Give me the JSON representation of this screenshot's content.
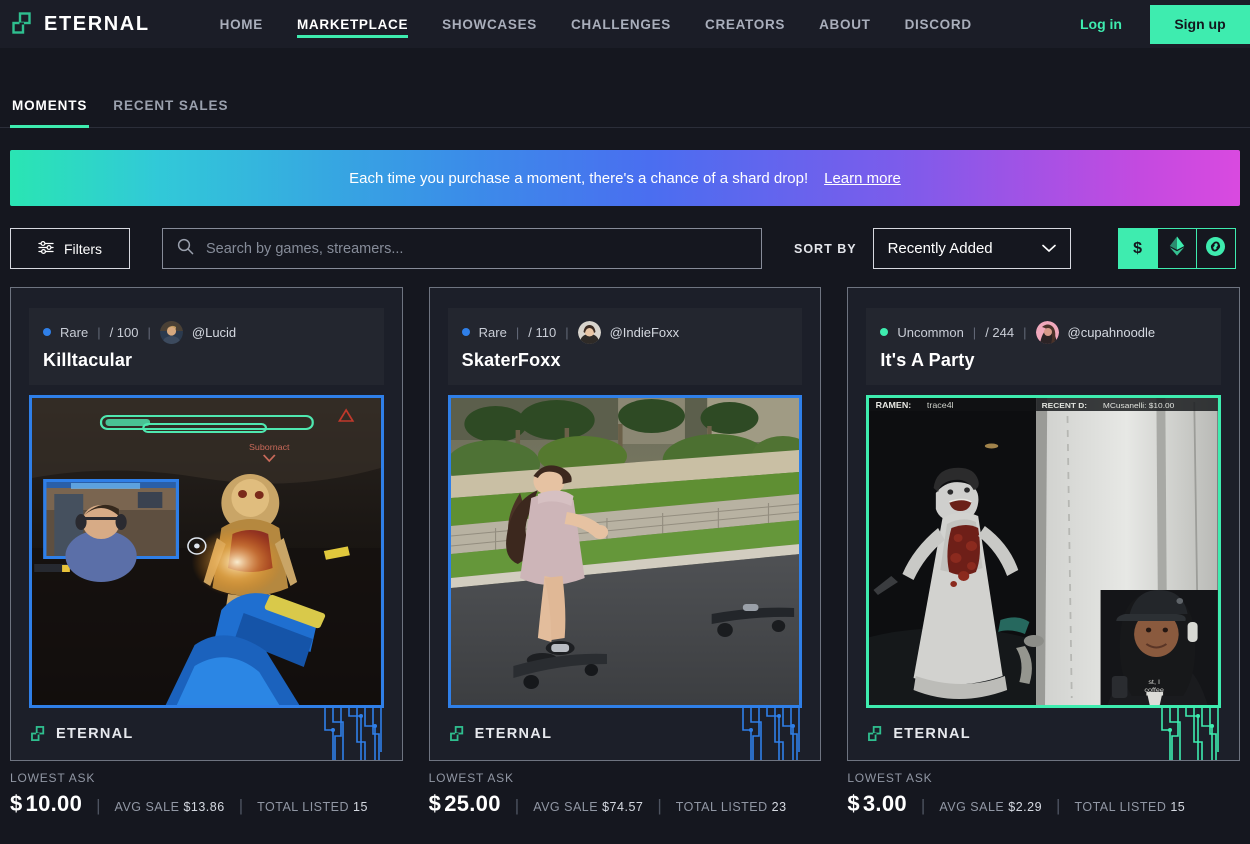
{
  "brand": {
    "name": "ETERNAL",
    "logo_icon": "eternal-squares-logo",
    "accent": "#3eecaf"
  },
  "nav": {
    "links": [
      {
        "label": "HOME",
        "active": false
      },
      {
        "label": "MARKETPLACE",
        "active": true
      },
      {
        "label": "SHOWCASES",
        "active": false
      },
      {
        "label": "CHALLENGES",
        "active": false
      },
      {
        "label": "CREATORS",
        "active": false
      },
      {
        "label": "ABOUT",
        "active": false
      },
      {
        "label": "DISCORD",
        "active": false
      }
    ],
    "login_label": "Log in",
    "signup_label": "Sign up"
  },
  "tabs": [
    {
      "label": "MOMENTS",
      "active": true
    },
    {
      "label": "RECENT SALES",
      "active": false
    }
  ],
  "banner": {
    "text": "Each time you purchase a moment, there's a chance of a shard drop!",
    "link_label": "Learn more",
    "gradient_from": "#2ae5b3",
    "gradient_to": "#d94ae0"
  },
  "controls": {
    "filters_label": "Filters",
    "filters_icon": "sliders-icon",
    "search_icon": "search-icon",
    "search_value": "",
    "search_placeholder": "Search by games, streamers...",
    "sort_label": "SORT BY",
    "sort_value": "Recently Added",
    "sort_caret_icon": "chevron-down-icon",
    "currencies": [
      {
        "name": "usd",
        "glyph": "$",
        "icon": "dollar-icon",
        "active": true
      },
      {
        "name": "eth",
        "glyph": "◆",
        "icon": "ethereum-icon",
        "active": false
      },
      {
        "name": "flow",
        "glyph": "●",
        "icon": "chain-link-icon",
        "active": false
      }
    ]
  },
  "cards": [
    {
      "rarity": "Rare",
      "rarity_color": "#2f7fe8",
      "serial": "/ 100",
      "handle": "@Lucid",
      "avatar_icon": "avatar-lucid",
      "title": "Killtacular",
      "frame_color": "#2f7fe8",
      "watermark": "ETERNAL",
      "thumbnail": "fps-game-with-webcam-overlay",
      "overlay_texts": [
        "Subornact"
      ],
      "lowest_ask_label": "LOWEST ASK",
      "price_currency": "$",
      "price": "10.00",
      "avg_sale_label": "AVG SALE",
      "avg_sale": "$13.86",
      "total_listed_label": "TOTAL LISTED",
      "total_listed": "15"
    },
    {
      "rarity": "Rare",
      "rarity_color": "#2f7fe8",
      "serial": "/ 110",
      "handle": "@IndieFoxx",
      "avatar_icon": "avatar-indiefoxx",
      "title": "SkaterFoxx",
      "frame_color": "#2f7fe8",
      "watermark": "ETERNAL",
      "thumbnail": "skateboarder-on-street",
      "overlay_texts": [],
      "lowest_ask_label": "LOWEST ASK",
      "price_currency": "$",
      "price": "25.00",
      "avg_sale_label": "AVG SALE",
      "avg_sale": "$74.57",
      "total_listed_label": "TOTAL LISTED",
      "total_listed": "23"
    },
    {
      "rarity": "Uncommon",
      "rarity_color": "#3eecaf",
      "serial": "/ 244",
      "handle": "@cupahnoodle",
      "avatar_icon": "avatar-cupahnoodle",
      "title": "It's A Party",
      "frame_color": "#3eecaf",
      "watermark": "ETERNAL",
      "thumbnail": "horror-game-with-webcam-overlay",
      "overlay_texts": [
        "RAMEN:  trace4l",
        "RECENT  D:  MCusanelli: $10.00"
      ],
      "lowest_ask_label": "LOWEST ASK",
      "price_currency": "$",
      "price": "3.00",
      "avg_sale_label": "AVG SALE",
      "avg_sale": "$2.29",
      "total_listed_label": "TOTAL LISTED",
      "total_listed": "15"
    }
  ]
}
